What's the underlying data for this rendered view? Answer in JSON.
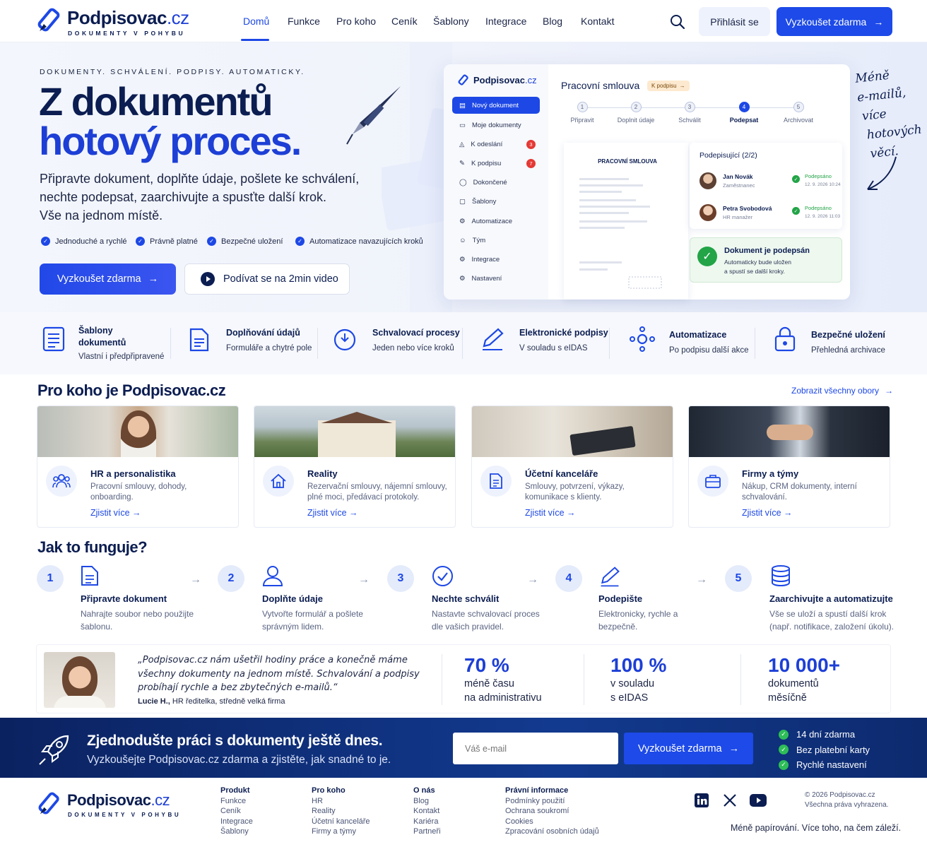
{
  "brand": {
    "name": "Podpisovac",
    "tld": ".cz",
    "tagline": "DOKUMENTY V POHYBU"
  },
  "nav": {
    "items": [
      "Domů",
      "Funkce",
      "Pro koho",
      "Ceník",
      "Šablony",
      "Integrace",
      "Blog",
      "Kontakt"
    ],
    "login": "Přihlásit se",
    "trial": "Vyzkoušet zdarma"
  },
  "hero": {
    "eyebrow": "DOKUMENTY. SCHVÁLENÍ. PODPISY. AUTOMATICKY.",
    "title_line1": "Z dokumentů",
    "title_line2": "hotový proces.",
    "lead_lines": [
      "Připravte dokument, doplňte údaje, pošlete ke schválení,",
      "nechte podepsat, zaarchivujte a spusťte další krok.",
      "Vše na jednom místě."
    ],
    "checks": [
      "Jednoduché a rychlé",
      "Právně platné",
      "Bezpečné uložení",
      "Automatizace navazujících kroků"
    ],
    "cta_primary": "Vyzkoušet zdarma",
    "cta_video": "Podívat se na 2min video",
    "handwritten": [
      "Méně",
      "e-mailů,",
      "více",
      "hotových",
      "věcí."
    ]
  },
  "mock": {
    "brand": "Podpisovac",
    "brand_tld": ".cz",
    "sidebar": [
      {
        "label": "Nový dokument",
        "icon": "file-plus-icon"
      },
      {
        "label": "Moje dokumenty",
        "icon": "folder-icon"
      },
      {
        "label": "K odeslání",
        "icon": "send-icon",
        "badge": "3"
      },
      {
        "label": "K podpisu",
        "icon": "pen-icon",
        "badge": "7"
      },
      {
        "label": "Dokončené",
        "icon": "check-circle-icon"
      },
      {
        "label": "Šablony",
        "icon": "template-icon"
      },
      {
        "label": "Automatizace",
        "icon": "gear-icon"
      },
      {
        "label": "Tým",
        "icon": "team-icon"
      },
      {
        "label": "Integrace",
        "icon": "integration-icon"
      },
      {
        "label": "Nastavení",
        "icon": "settings-icon"
      }
    ],
    "doc_title": "Pracovní smlouva",
    "status": "K podpisu",
    "steps": [
      {
        "n": "1",
        "label": "Připravit"
      },
      {
        "n": "2",
        "label": "Doplnit údaje"
      },
      {
        "n": "3",
        "label": "Schválit"
      },
      {
        "n": "4",
        "label": "Podepsat"
      },
      {
        "n": "5",
        "label": "Archivovat"
      }
    ],
    "current_step": 4,
    "preview_title": "PRACOVNÍ SMLOUVA",
    "signers_title": "Podepisující (2/2)",
    "signers": [
      {
        "name": "Jan Novák",
        "role": "Zaměstnanec",
        "status": "Podepsáno",
        "date": "12. 9. 2026 10:24"
      },
      {
        "name": "Petra Svobodová",
        "role": "HR manažer",
        "status": "Podepsáno",
        "date": "12. 9. 2026 11:03"
      }
    ],
    "done_title": "Dokument je podepsán",
    "done_text": [
      "Automaticky bude uložen",
      "a spustí se další kroky."
    ]
  },
  "features": [
    {
      "title": "Šablony dokumentů",
      "sub": "Vlastní i předpřipravené",
      "icon": "document-icon"
    },
    {
      "title": "Doplňování údajů",
      "sub": "Formuláře a chytré pole",
      "icon": "form-icon"
    },
    {
      "title": "Schvalovací procesy",
      "sub": "Jeden nebo více kroků",
      "icon": "approval-icon"
    },
    {
      "title": "Elektronické podpisy",
      "sub": "V souladu s eIDAS",
      "icon": "signature-icon"
    },
    {
      "title": "Automatizace",
      "sub": "Po podpisu další akce",
      "icon": "automation-icon"
    },
    {
      "title": "Bezpečné uložení",
      "sub": "Přehledná archivace",
      "icon": "lock-icon"
    }
  ],
  "audience": {
    "title": "Pro koho je Podpisovac.cz",
    "all_link": "Zobrazit všechny obory",
    "cards": [
      {
        "title": "HR a personalistika",
        "desc": "Pracovní smlouvy, dohody, onboarding.",
        "link": "Zjistit více",
        "icon": "people-icon"
      },
      {
        "title": "Reality",
        "desc": "Rezervační smlouvy, nájemní smlouvy, plné moci, předávací protokoly.",
        "link": "Zjistit více",
        "icon": "house-icon"
      },
      {
        "title": "Účetní kanceláře",
        "desc": "Smlouvy, potvrzení, výkazy, komunikace s klienty.",
        "link": "Zjistit více",
        "icon": "ledger-icon"
      },
      {
        "title": "Firmy a týmy",
        "desc": "Nákup, CRM dokumenty, interní schvalování.",
        "link": "Zjistit více",
        "icon": "briefcase-icon"
      }
    ]
  },
  "how": {
    "title": "Jak to funguje?",
    "steps": [
      {
        "n": "1",
        "title": "Připravte dokument",
        "desc": "Nahrajte soubor nebo použijte šablonu."
      },
      {
        "n": "2",
        "title": "Doplňte údaje",
        "desc": "Vytvořte formulář a pošlete správným lidem."
      },
      {
        "n": "3",
        "title": "Nechte schválit",
        "desc": "Nastavte schvalovací proces dle vašich pravidel."
      },
      {
        "n": "4",
        "title": "Podepište",
        "desc": "Elektronicky, rychle a bezpečně."
      },
      {
        "n": "5",
        "title": "Zaarchivujte a automatizujte",
        "desc": "Vše se uloží a spustí další krok (např. notifikace, založení úkolu)."
      }
    ]
  },
  "testimonial": {
    "quote": [
      "„Podpisovac.cz nám ušetřil hodiny práce a konečně máme",
      "všechny dokumenty na jednom místě. Schvalování a podpisy",
      "probíhají rychle a bez zbytečných e-mailů.“"
    ],
    "author": "Lucie H.,",
    "role": " HR ředitelka, středně velká firma"
  },
  "stats": [
    {
      "value": "70 %",
      "label": [
        "méně času",
        "na administrativu"
      ]
    },
    {
      "value": "100 %",
      "label": [
        "v souladu",
        "s eIDAS"
      ]
    },
    {
      "value": "10 000+",
      "label": [
        "dokumentů",
        "měsíčně"
      ]
    }
  ],
  "cta": {
    "title": "Zjednodušte práci s dokumenty ještě dnes.",
    "sub": "Vyzkoušejte Podpisovac.cz zdarma a zjistěte, jak snadné to je.",
    "placeholder": "Váš e-mail",
    "button": "Vyzkoušet zdarma",
    "checks": [
      "14 dní zdarma",
      "Bez platební karty",
      "Rychlé nastavení"
    ]
  },
  "footer": {
    "cols": [
      {
        "title": "Produkt",
        "items": [
          "Funkce",
          "Ceník",
          "Integrace",
          "Šablony"
        ]
      },
      {
        "title": "Pro koho",
        "items": [
          "HR",
          "Reality",
          "Účetní kanceláře",
          "Firmy a týmy"
        ]
      },
      {
        "title": "O nás",
        "items": [
          "Blog",
          "Kontakt",
          "Kariéra",
          "Partneři"
        ]
      },
      {
        "title": "Právní informace",
        "items": [
          "Podmínky použití",
          "Ochrana soukromí",
          "Cookies",
          "Zpracování osobních údajů"
        ]
      }
    ],
    "copyright": "© 2026 Podpisovac.cz",
    "rights": "Všechna práva vyhrazena.",
    "slogan": "Méně papírování. Více toho, na čem záleží.",
    "social": [
      "linkedin-icon",
      "x-icon",
      "youtube-icon"
    ]
  },
  "colors": {
    "primary": "#1d48e6",
    "navy": "#0b1d51",
    "success": "#22a447",
    "danger": "#e53935"
  }
}
